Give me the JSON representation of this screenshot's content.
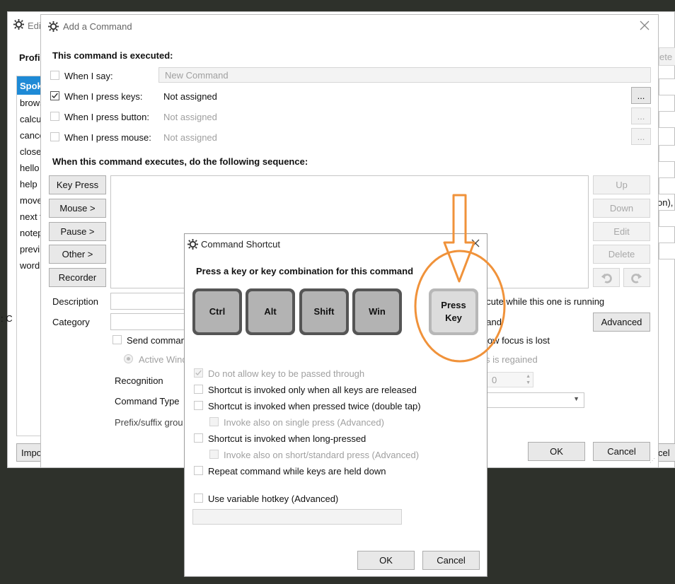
{
  "back_window": {
    "title": "Edi",
    "profile_label": "Profi",
    "list_header": "Spok",
    "list_items": [
      "brows",
      "calcul",
      "cance",
      "close",
      "hello",
      "help",
      "move",
      "next t",
      "notep",
      "previ",
      "word"
    ],
    "right_fragments": [
      "ete",
      "on), l"
    ],
    "import_label": "Impo",
    "cancel_fragment": "cel",
    "left_fragment": ": C"
  },
  "add_command": {
    "title": "Add a Command",
    "executed_header": "This command is executed:",
    "when_i_say": "When I say:",
    "say_placeholder": "New Command",
    "when_keys": "When I press keys:",
    "keys_value": "Not assigned",
    "when_button": "When I press button:",
    "button_value": "Not assigned",
    "when_mouse": "When I press mouse:",
    "mouse_value": "Not assigned",
    "dots": "...",
    "sequence_header": "When this command executes, do the following sequence:",
    "key_press": "Key Press",
    "mouse": "Mouse >",
    "pause": "Pause >",
    "other": "Other >",
    "recorder": "Recorder",
    "up": "Up",
    "down": "Down",
    "edit": "Edit",
    "delete": "Delete",
    "description": "Description",
    "category": "Category",
    "send_command": "Send comman",
    "active_window": "Active Wind",
    "recognition": "Recognition",
    "command_type": "Command Type",
    "prefix_suffix": "Prefix/suffix grou",
    "execute_while": "ecute while this one is running",
    "advanced": "Advanced",
    "right_partial": "hand",
    "focus_lost": "low focus is lost",
    "regained": "s is regained",
    "spinner_value": "0",
    "ok": "OK",
    "cancel": "Cancel"
  },
  "shortcut_dialog": {
    "title": "Command Shortcut",
    "instruction": "Press a key or key combination for this command",
    "keys": [
      "Ctrl",
      "Alt",
      "Shift",
      "Win"
    ],
    "press_key_line1": "Press",
    "press_key_line2": "Key",
    "opt_no_pass": "Do not allow key to be passed through",
    "opt_all_released": "Shortcut is invoked only when all keys are released",
    "opt_double_tap": "Shortcut is invoked when pressed twice (double tap)",
    "opt_single_press": "Invoke also on single press (Advanced)",
    "opt_long_press": "Shortcut is invoked when long-pressed",
    "opt_short_press": "Invoke also on short/standard press (Advanced)",
    "opt_repeat": "Repeat command while keys are held down",
    "opt_variable": "Use variable hotkey (Advanced)",
    "ok": "OK",
    "cancel": "Cancel"
  },
  "colors": {
    "annotation": "#f0923a",
    "accent": "#1e8ad6",
    "taskbar": "#2e312b"
  },
  "icons": [
    "gear-icon",
    "close-icon",
    "check-icon",
    "undo-icon",
    "redo-icon",
    "dropdown-icon",
    "arrow-annotation"
  ]
}
